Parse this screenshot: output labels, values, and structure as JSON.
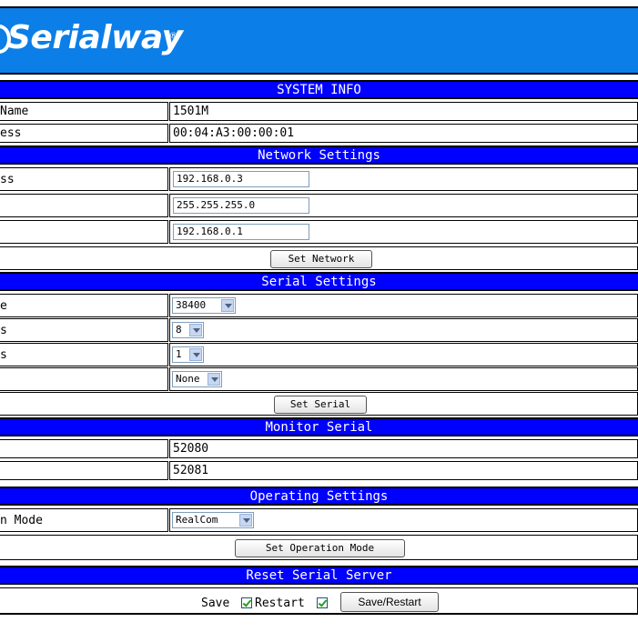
{
  "brand": {
    "name": "Serialway",
    "reg": "®"
  },
  "system_info": {
    "title": "SYSTEM INFO",
    "rows": [
      {
        "label": "Name",
        "value": "1501M"
      },
      {
        "label": "ess",
        "value": "00:04:A3:00:00:01"
      }
    ]
  },
  "network": {
    "title": "Network Settings",
    "rows": [
      {
        "label": "ss",
        "value": "192.168.0.3"
      },
      {
        "label": "",
        "value": "255.255.255.0"
      },
      {
        "label": "",
        "value": "192.168.0.1"
      }
    ],
    "button": "Set Network"
  },
  "serial": {
    "title": "Serial Settings",
    "rows": [
      {
        "label": "e",
        "value": "38400"
      },
      {
        "label": "s",
        "value": "8"
      },
      {
        "label": "s",
        "value": "1"
      },
      {
        "label": "",
        "value": "None"
      }
    ],
    "button": "Set Serial"
  },
  "monitor": {
    "title": "Monitor Serial",
    "rows": [
      {
        "label": "",
        "value": "52080"
      },
      {
        "label": "",
        "value": "52081"
      }
    ]
  },
  "operating": {
    "title": "Operating Settings",
    "rows": [
      {
        "label": "n Mode",
        "value": "RealCom"
      }
    ],
    "button": "Set Operation Mode"
  },
  "reset": {
    "title": "Reset Serial Server",
    "save_label": "Save",
    "restart_label": "Restart",
    "button": "Save/Restart"
  }
}
